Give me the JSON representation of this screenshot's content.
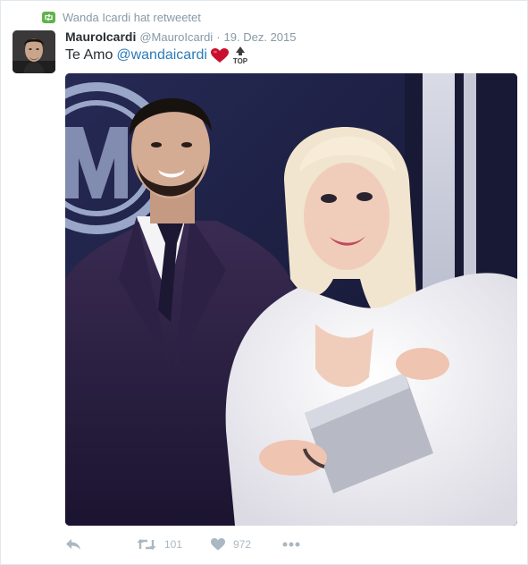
{
  "retweet_context": {
    "icon": "retweet-icon",
    "text": "Wanda Icardi hat retweetet",
    "badge_color": "#5fb34a"
  },
  "tweet": {
    "display_name": "MauroIcardi",
    "screen_name": "@MauroIcardi",
    "separator": "·",
    "timestamp": "19. Dez. 2015",
    "text": "Te Amo",
    "mention": "@wandaicardi",
    "emojis": [
      "red-heart-emoji",
      "top-arrow-emoji"
    ],
    "emoji_top_label": "TOP",
    "link_color": "#2b7bb9"
  },
  "actions": {
    "reply": {
      "icon": "reply-icon"
    },
    "retweet": {
      "icon": "retweet-icon",
      "count": "101"
    },
    "like": {
      "icon": "heart-icon",
      "count": "972"
    },
    "more": {
      "icon": "more-dots-icon"
    }
  }
}
